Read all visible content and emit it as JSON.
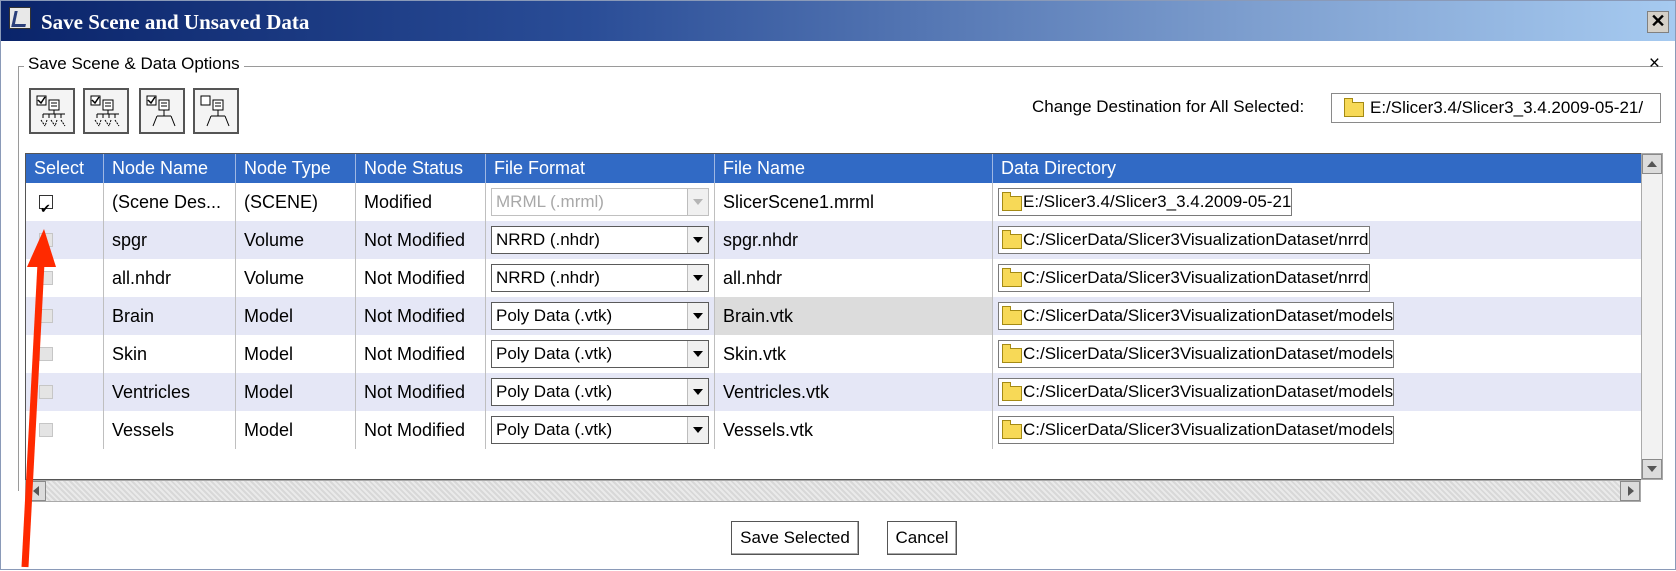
{
  "window": {
    "title": "Save Scene and Unsaved Data",
    "close_glyph": "✕"
  },
  "options_group": {
    "title": "Save Scene & Data Options",
    "close_glyph": "×"
  },
  "toolbar": {
    "buttons": [
      {
        "icon": "select-all-nodes-icon"
      },
      {
        "icon": "select-data-nodes-icon"
      },
      {
        "icon": "select-modified-nodes-icon"
      },
      {
        "icon": "deselect-all-nodes-icon"
      }
    ]
  },
  "destination": {
    "label": "Change Destination for All Selected:",
    "value": "E:/Slicer3.4/Slicer3_3.4.2009-05-21/"
  },
  "table": {
    "columns": [
      "Select",
      "Node Name",
      "Node Type",
      "Node Status",
      "File Format",
      "File Name",
      "Data Directory"
    ],
    "rows": [
      {
        "checked": true,
        "node_name": "(Scene Des...",
        "node_type": "(SCENE)",
        "node_status": "Modified",
        "file_format": "MRML (.mrml)",
        "format_disabled": true,
        "file_name": "SlicerScene1.mrml",
        "data_directory": "E:/Slicer3.4/Slicer3_3.4.2009-05-21"
      },
      {
        "checked": false,
        "node_name": "spgr",
        "node_type": "Volume",
        "node_status": "Not Modified",
        "file_format": "NRRD (.nhdr)",
        "format_disabled": false,
        "file_name": "spgr.nhdr",
        "data_directory": "C:/SlicerData/Slicer3VisualizationDataset/nrrd"
      },
      {
        "checked": false,
        "node_name": "all.nhdr",
        "node_type": "Volume",
        "node_status": "Not Modified",
        "file_format": "NRRD (.nhdr)",
        "format_disabled": false,
        "file_name": "all.nhdr",
        "data_directory": "C:/SlicerData/Slicer3VisualizationDataset/nrrd"
      },
      {
        "checked": false,
        "node_name": "Brain",
        "node_type": "Model",
        "node_status": "Not Modified",
        "file_format": "Poly Data (.vtk)",
        "format_disabled": false,
        "file_name": "Brain.vtk",
        "data_directory": "C:/SlicerData/Slicer3VisualizationDataset/models"
      },
      {
        "checked": false,
        "node_name": "Skin",
        "node_type": "Model",
        "node_status": "Not Modified",
        "file_format": "Poly Data (.vtk)",
        "format_disabled": false,
        "file_name": "Skin.vtk",
        "data_directory": "C:/SlicerData/Slicer3VisualizationDataset/models"
      },
      {
        "checked": false,
        "node_name": "Ventricles",
        "node_type": "Model",
        "node_status": "Not Modified",
        "file_format": "Poly Data (.vtk)",
        "format_disabled": false,
        "file_name": "Ventricles.vtk",
        "data_directory": "C:/SlicerData/Slicer3VisualizationDataset/models"
      },
      {
        "checked": false,
        "node_name": "Vessels",
        "node_type": "Model",
        "node_status": "Not Modified",
        "file_format": "Poly Data (.vtk)",
        "format_disabled": false,
        "file_name": "Vessels.vtk",
        "data_directory": "C:/SlicerData/Slicer3VisualizationDataset/models"
      }
    ]
  },
  "buttons": {
    "save": "Save Selected",
    "cancel": "Cancel"
  },
  "annotation": {
    "color": "#ff2a00"
  }
}
